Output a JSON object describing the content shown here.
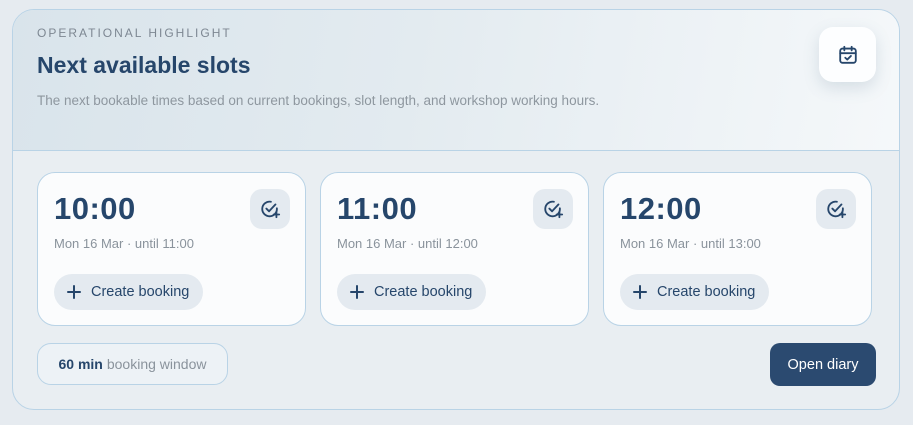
{
  "header": {
    "eyebrow": "OPERATIONAL HIGHLIGHT",
    "title": "Next available slots",
    "description": "The next bookable times based on current bookings, slot length, and workshop working hours.",
    "calendar_icon": "calendar-check-icon"
  },
  "slots": [
    {
      "time": "10:00",
      "subtitle": "Mon 16 Mar · until 11:00",
      "action": "Create booking"
    },
    {
      "time": "11:00",
      "subtitle": "Mon 16 Mar · until 12:00",
      "action": "Create booking"
    },
    {
      "time": "12:00",
      "subtitle": "Mon 16 Mar · until 13:00",
      "action": "Create booking"
    }
  ],
  "footer": {
    "window_value": "60 min",
    "window_label": "booking window",
    "open_diary": "Open diary"
  },
  "colors": {
    "primary": "#26466b",
    "button": "#2b4a70",
    "border": "#b9d3e6",
    "muted": "#8a939c"
  }
}
